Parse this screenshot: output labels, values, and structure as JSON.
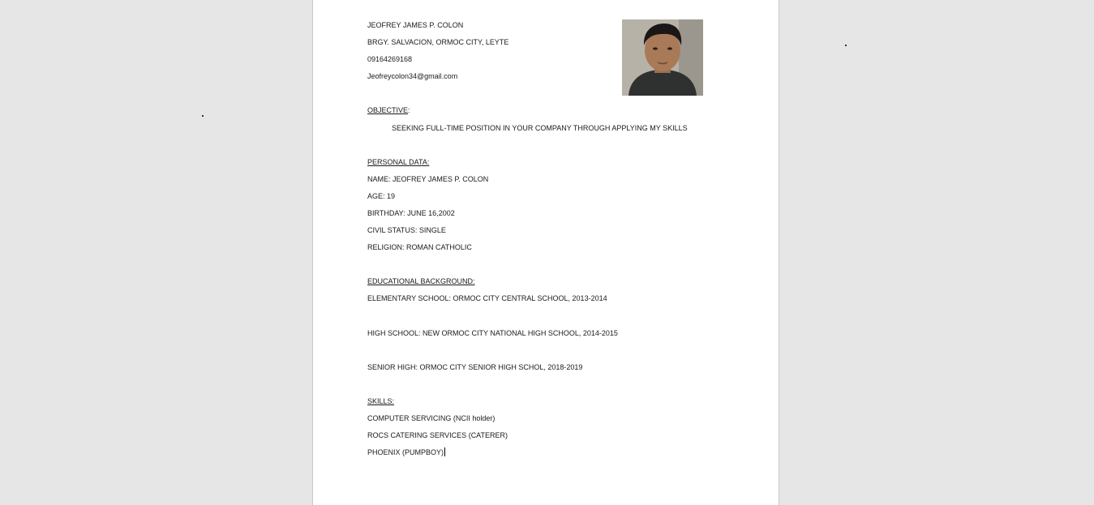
{
  "resume": {
    "header": {
      "name": "JEOFREY JAMES P. COLON",
      "address": "BRGY. SALVACION, ORMOC CITY, LEYTE",
      "phone": "09164269168",
      "email": "Jeofreycolon34@gmail.com"
    },
    "objective": {
      "heading": "OBJECTIVE",
      "colon": ":",
      "text": "SEEKING FULL-TIME POSITION IN YOUR COMPANY THROUGH APPLYING MY SKILLS"
    },
    "personal_data": {
      "heading": "PERSONAL DATA:",
      "items": [
        "NAME: JEOFREY JAMES P. COLON",
        "AGE: 19",
        "BIRTHDAY: JUNE 16,2002",
        "CIVIL STATUS: SINGLE",
        "RELIGION: ROMAN CATHOLIC"
      ]
    },
    "education": {
      "heading": "EDUCATIONAL BACKGROUND:",
      "items": [
        "ELEMENTARY SCHOOL: ORMOC CITY CENTRAL SCHOOL, 2013-2014",
        "HIGH SCHOOL: NEW ORMOC CITY NATIONAL HIGH SCHOOL, 2014-2015",
        "SENIOR HIGH: ORMOC CITY SENIOR HIGH SCHOL, 2018-2019"
      ]
    },
    "skills": {
      "heading": "SKILLS:",
      "items": [
        "COMPUTER SERVICING (NCII holder)",
        "ROCS CATERING SERVICES (CATERER)",
        "PHOENIX (PUMPBOY)"
      ]
    }
  }
}
